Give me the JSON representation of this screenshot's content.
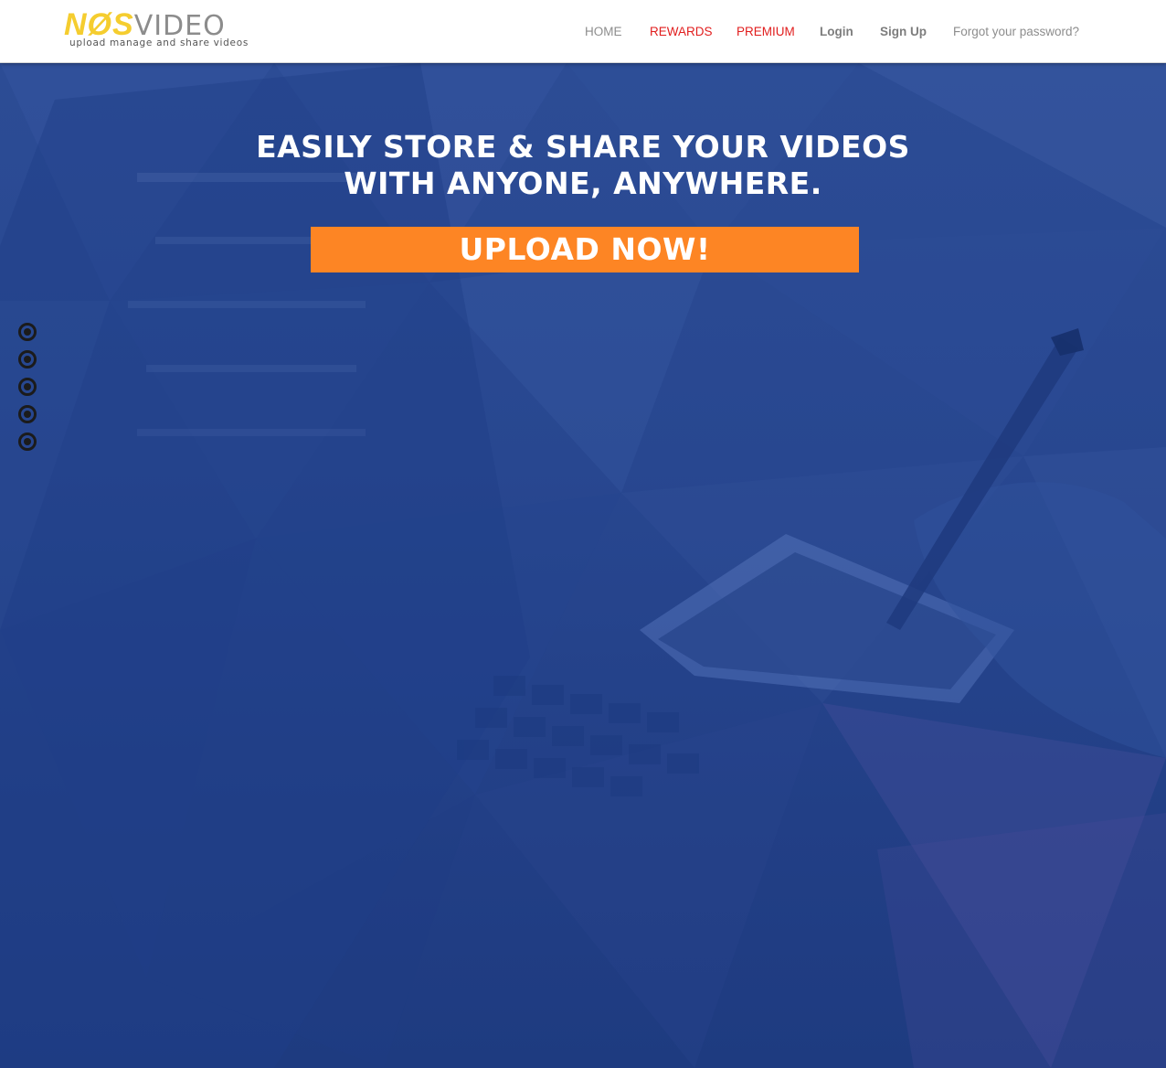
{
  "brand": {
    "logo_part1": "NØS",
    "logo_part2": "VIDEO",
    "tagline": "upload manage and share videos"
  },
  "nav": {
    "home": "HOME",
    "rewards": "REWARDS",
    "premium": "PREMIUM",
    "login": "Login",
    "signup": "Sign Up",
    "forgot": "Forgot your password?"
  },
  "hero": {
    "headline_line1": "Easily store & share your videos",
    "headline_line2": "with anyone, anywhere.",
    "cta_label": "Upload now!"
  },
  "slider": {
    "dot_count": 5
  },
  "colors": {
    "accent_orange": "#fd8524",
    "logo_yellow": "#f5cd2f",
    "nav_highlight_red": "#e11d1d",
    "hero_blue": "#2a4a92"
  }
}
